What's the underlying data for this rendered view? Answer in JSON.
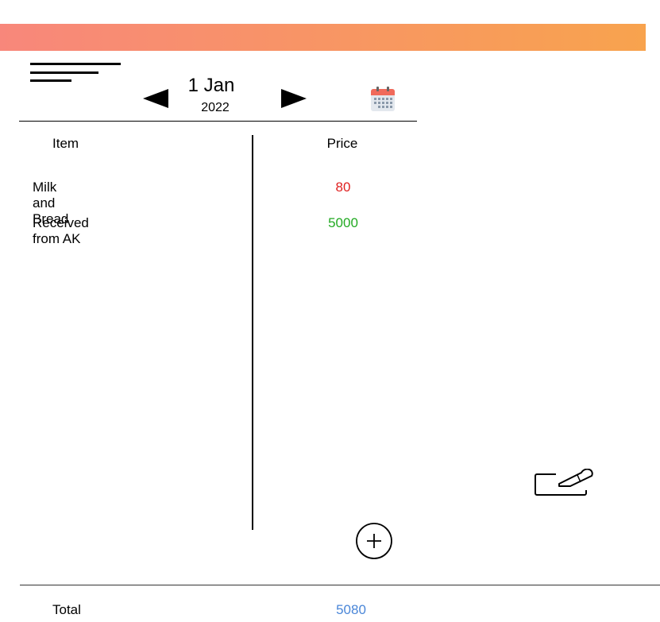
{
  "header": {
    "day_month": "1 Jan",
    "year": "2022",
    "prev_icon": "triangle-left-icon",
    "next_icon": "triangle-right-icon",
    "calendar_icon": "calendar-icon",
    "menu_icon": "hamburger-icon"
  },
  "columns": {
    "item": "Item",
    "price": "Price"
  },
  "rows": [
    {
      "item": "Milk and Bread",
      "price": "80",
      "price_color": "#e02020"
    },
    {
      "item": "Received from AK",
      "price": "5000",
      "price_color": "#22aa22"
    }
  ],
  "footer": {
    "total_label": "Total",
    "total_value": "5080",
    "total_color": "#4a86d8"
  },
  "colors": {
    "header_gradient_start": "#f8877b",
    "header_gradient_end": "#f8a34e"
  },
  "actions": {
    "edit_icon": "edit-pencil-icon",
    "add_icon": "plus-circle-icon"
  }
}
